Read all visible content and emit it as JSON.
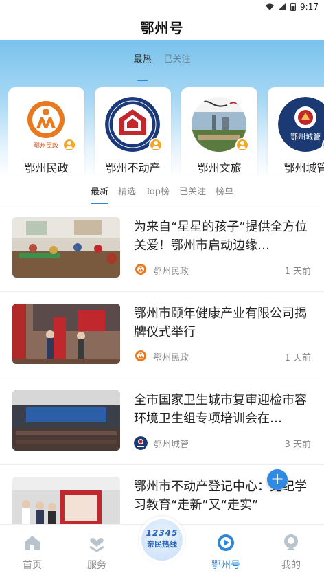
{
  "status_bar": {
    "time": "9:17"
  },
  "app": {
    "title": "鄂州号"
  },
  "top_tabs": [
    {
      "label": "最热",
      "active": true
    },
    {
      "label": "已关注",
      "active": false
    }
  ],
  "channels": [
    {
      "name": "鄂州民政",
      "icon": "civil-affairs-logo"
    },
    {
      "name": "鄂州不动产",
      "icon": "real-estate-registration-logo"
    },
    {
      "name": "鄂州文旅",
      "icon": "culture-tourism-logo"
    },
    {
      "name": "鄂州城管",
      "icon": "urban-management-logo"
    }
  ],
  "sub_tabs": [
    {
      "label": "最新",
      "active": true
    },
    {
      "label": "精选",
      "active": false
    },
    {
      "label": "Top榜",
      "active": false
    },
    {
      "label": "已关注",
      "active": false
    },
    {
      "label": "榜单",
      "active": false
    }
  ],
  "news": [
    {
      "headline": "为来自“星星的孩子”提供全方位关爱！鄂州市启动边缘…",
      "source": "鄂州民政",
      "time": "1 天前"
    },
    {
      "headline": "鄂州市颐年健康产业有限公司揭牌仪式举行",
      "source": "鄂州民政",
      "time": "1 天前"
    },
    {
      "headline": "全市国家卫生城市复审迎检市容环境卫生组专项培训会在…",
      "source": "鄂州城管",
      "time": "3 天前"
    },
    {
      "headline": "鄂州市不动产登记中心：党纪学习教育“走新”又“走实”",
      "source": "",
      "time": ""
    }
  ],
  "fab": {
    "label": "+"
  },
  "hotline": {
    "number": "12345",
    "text": "亲民热线"
  },
  "bottom_nav": [
    {
      "label": "首页",
      "icon": "home-icon",
      "active": false
    },
    {
      "label": "服务",
      "icon": "service-heart-icon",
      "active": false
    },
    {
      "label": "鄂州号",
      "icon": "channel-icon",
      "active": true
    },
    {
      "label": "我的",
      "icon": "profile-icon",
      "active": false
    }
  ],
  "colors": {
    "accent": "#2f86d8",
    "header_top": "#79c2ec",
    "badge": "#f5a623"
  }
}
